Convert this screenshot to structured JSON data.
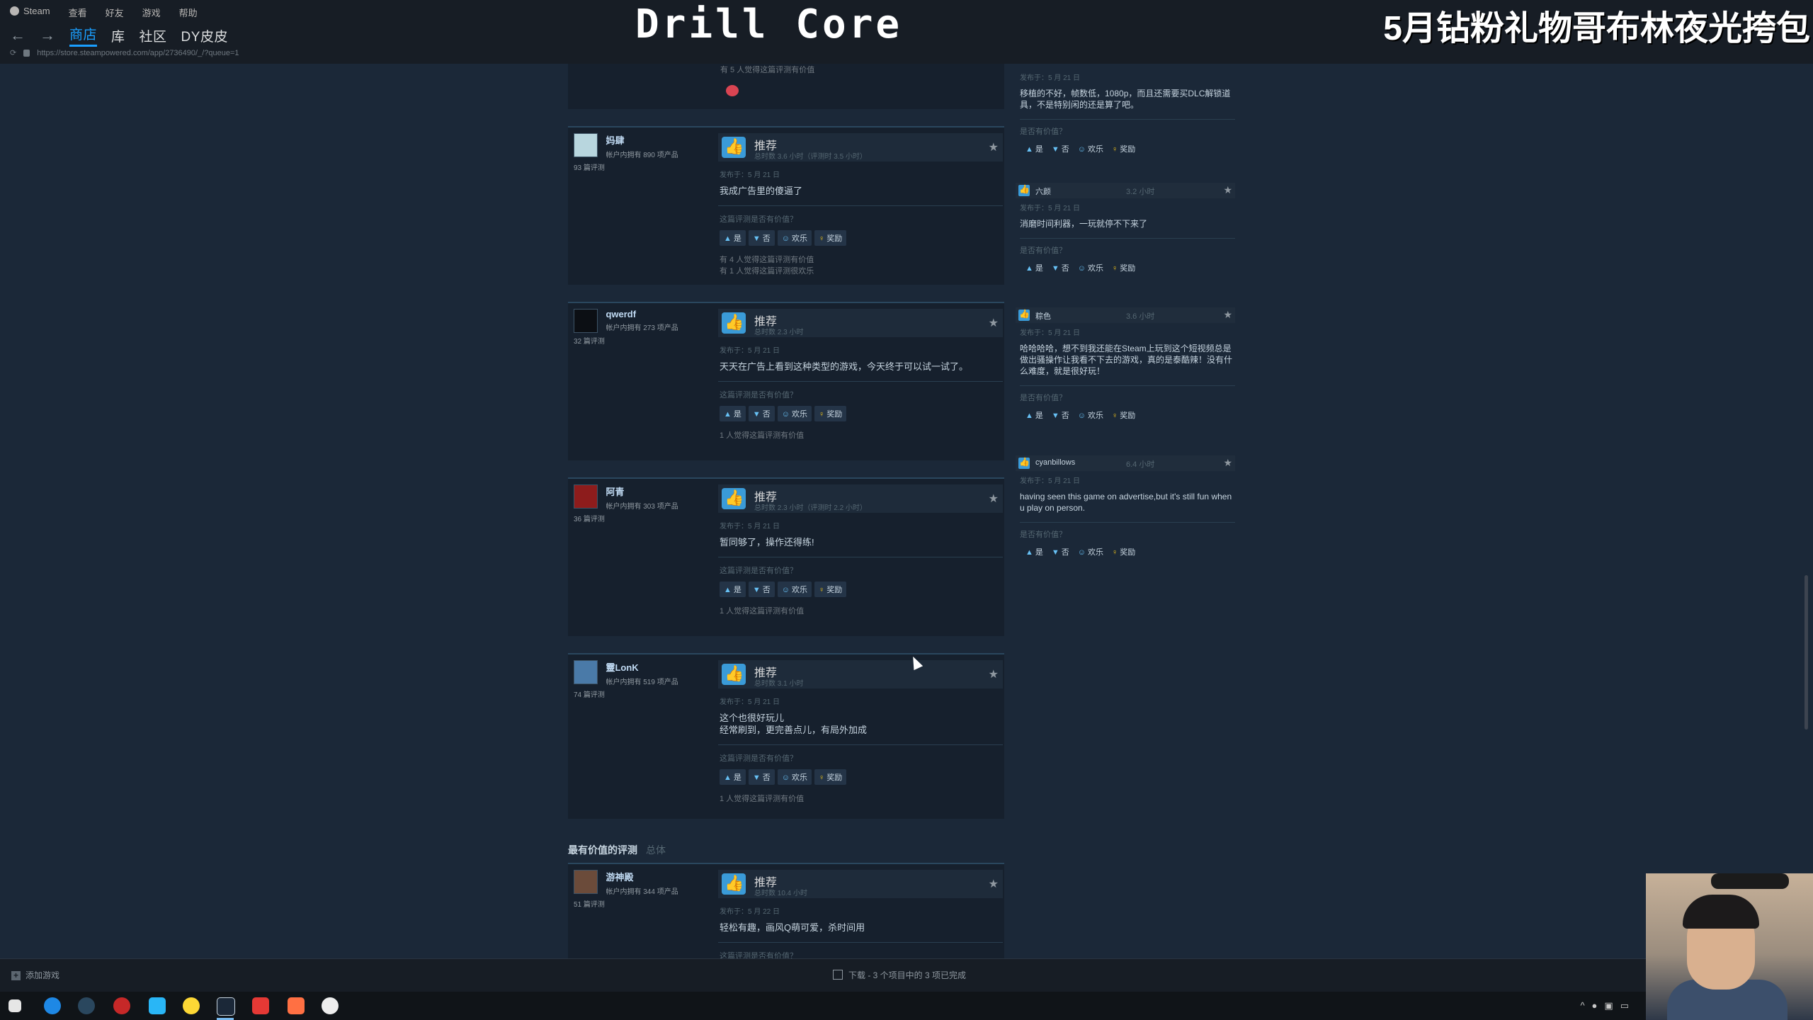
{
  "menu": [
    "Steam",
    "查看",
    "好友",
    "游戏",
    "帮助"
  ],
  "nav": {
    "back": "←",
    "forward": "→",
    "tabs": [
      "商店",
      "库",
      "社区",
      "DY皮皮"
    ]
  },
  "url": "https://store.steampowered.com/app/2736490/_/?queue=1",
  "overlay": {
    "title": "Drill Core",
    "promo": "5月钻粉礼物哥布林夜光挎包"
  },
  "reviews": {
    "top_tail": {
      "helpful": "有 5 人觉得这篇评测有价值"
    },
    "labels": {
      "recommended": "推荐",
      "question": "这篇评测是否有价值？",
      "yes": "是",
      "no": "否",
      "funny": "欢乐",
      "award": "奖励"
    },
    "items": [
      {
        "name": "妈肆",
        "owned": "帐户内拥有 890 项产品",
        "count": "93 篇评测",
        "hours": "总时数 3.6 小时（评测时 3.5 小时）",
        "posted": "发布于：5 月 21 日",
        "text": "我成广告里的傻逼了",
        "helpful": "有 4 人觉得这篇评测有价值\n有 1 人觉得这篇评测很欢乐"
      },
      {
        "name": "qwerdf",
        "owned": "帐户内拥有 273 项产品",
        "count": "32 篇评测",
        "hours": "总时数 2.3 小时",
        "posted": "发布于：5 月 21 日",
        "text": "天天在广告上看到这种类型的游戏，今天终于可以试一试了。",
        "helpful": "1 人觉得这篇评测有价值"
      },
      {
        "name": "阿青",
        "owned": "帐户内拥有 303 项产品",
        "count": "36 篇评测",
        "hours": "总时数 2.3 小时（评测时 2.2 小时）",
        "posted": "发布于：5 月 21 日",
        "text": "暂同够了，操作还得练!",
        "helpful": "1 人觉得这篇评测有价值"
      },
      {
        "name": "靈LonK",
        "owned": "帐户内拥有 519 项产品",
        "count": "74 篇评测",
        "hours": "总时数 3.1 小时",
        "posted": "发布于：5 月 21 日",
        "text": "这个也很好玩儿\n经常刷到，更完善点儿，有局外加成",
        "helpful": "1 人觉得这篇评测有价值"
      }
    ],
    "most_helpful": {
      "title": "最有价值的评测",
      "sub": "总体",
      "item": {
        "name": "游神殿",
        "owned": "帐户内拥有 344 项产品",
        "count": "51 篇评测",
        "hours": "总时数 10.4 小时",
        "posted": "发布于：5 月 22 日",
        "text": "轻松有趣，画风Q萌可爱，杀时间用"
      }
    }
  },
  "side": {
    "first": {
      "date": "发布于：5 月 21 日",
      "text": "移植的不好，帧数低，1080p，而且还需要买DLC解锁道具，不是特别闲的还是算了吧。"
    },
    "items": [
      {
        "name": "六颜",
        "hours": "3.2 小时",
        "date": "发布于：5 月 21 日",
        "text": "消磨时间利器，一玩就停不下来了"
      },
      {
        "name": "粽色",
        "hours": "3.6 小时",
        "date": "发布于：5 月 21 日",
        "text": "哈哈哈哈，想不到我还能在Steam上玩到这个短视频总是做出骚操作让我看不下去的游戏，真的是泰酷辣！没有什么难度，就是很好玩！"
      },
      {
        "name": "cyanbillows",
        "hours": "6.4 小时",
        "date": "发布于：5 月 21 日",
        "text": "having seen this game on advertise,but it's still fun when u play on person."
      }
    ],
    "question": "是否有价值？"
  },
  "status": {
    "add_game": "添加游戏",
    "downloads": "下载 - 3 个项目中的 3 项已完成"
  },
  "colors": {
    "background": "#1b2838",
    "accent": "#1a9fff",
    "thumb": "#3a9bd8"
  }
}
